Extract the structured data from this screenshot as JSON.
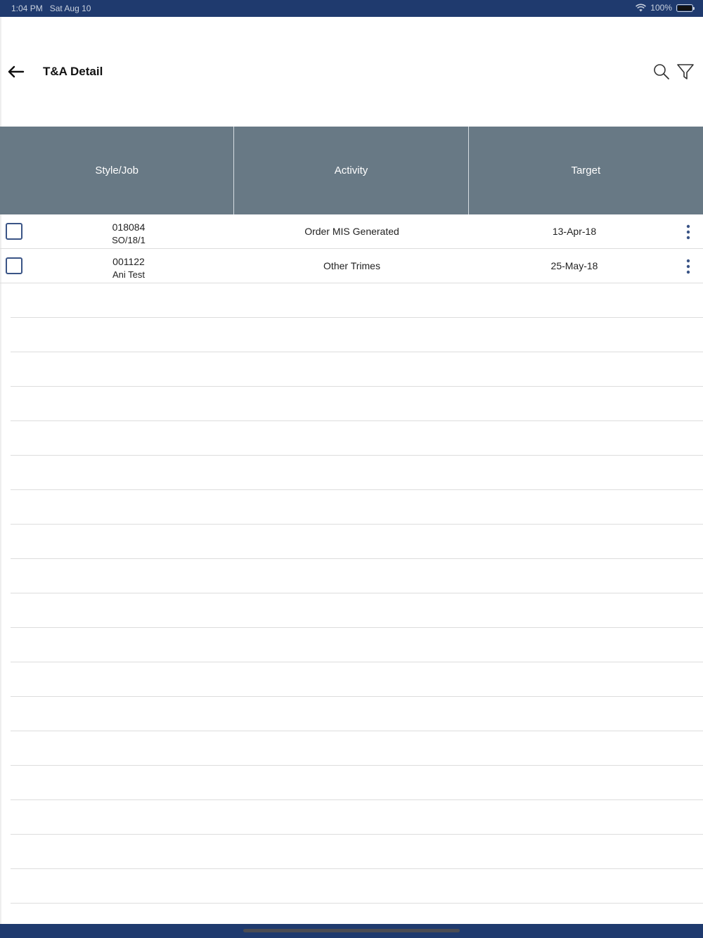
{
  "status_bar": {
    "time": "1:04 PM",
    "date": "Sat Aug 10",
    "battery": "100%",
    "icons": [
      "wifi-icon",
      "battery-icon"
    ]
  },
  "header": {
    "title": "T&A Detail",
    "icons": [
      "back-arrow-icon",
      "search-icon",
      "filter-icon"
    ]
  },
  "table": {
    "columns": [
      "Style/Job",
      "Activity",
      "Target"
    ],
    "rows": [
      {
        "style": "018084",
        "job": "SO/18/1",
        "activity": "Order MIS Generated",
        "target": "13-Apr-18"
      },
      {
        "style": "001122",
        "job": "Ani Test",
        "activity": "Other Trimes",
        "target": "25-May-18"
      }
    ]
  },
  "colors": {
    "status_bar_bg": "#1f3a6e",
    "table_header_bg": "#687985",
    "accent": "#3a5486"
  }
}
